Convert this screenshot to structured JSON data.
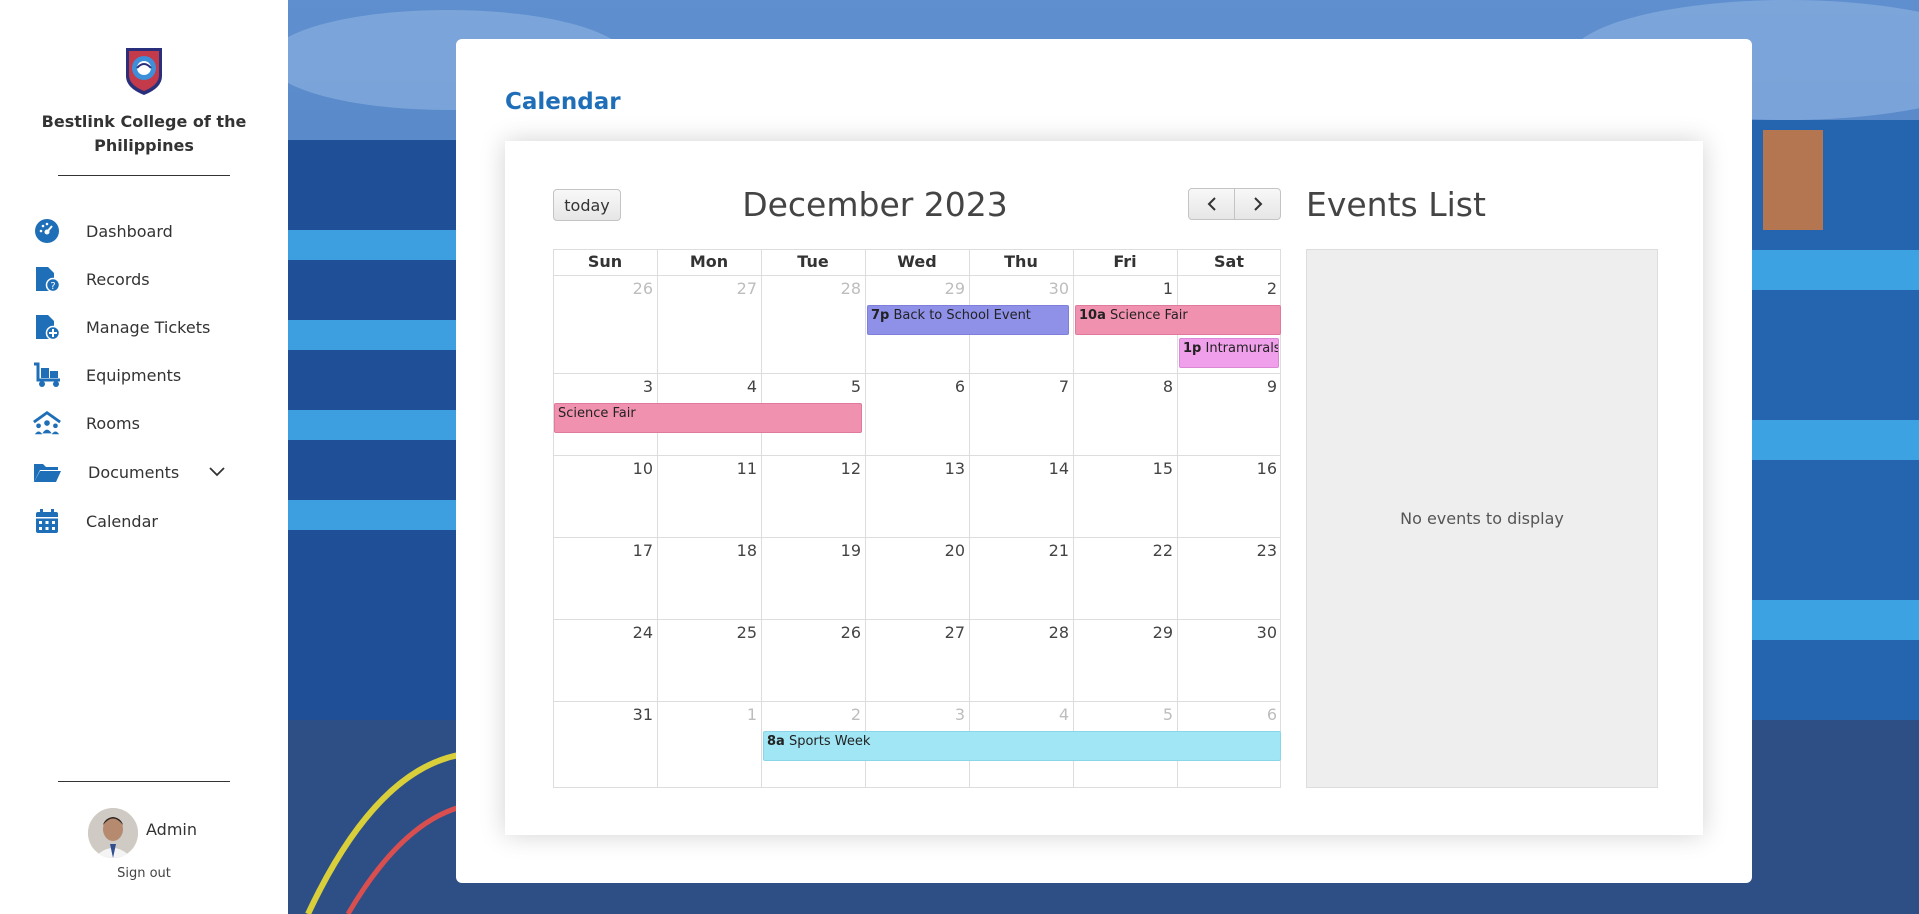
{
  "sidebar": {
    "college_name": "Bestlink College of the Philippines",
    "items": [
      {
        "label": "Dashboard",
        "icon": "dashboard-icon"
      },
      {
        "label": "Records",
        "icon": "records-icon"
      },
      {
        "label": "Manage Tickets",
        "icon": "manage-tickets-icon"
      },
      {
        "label": "Equipments",
        "icon": "equipments-icon"
      },
      {
        "label": "Rooms",
        "icon": "rooms-icon"
      },
      {
        "label": "Documents",
        "icon": "folder-icon"
      },
      {
        "label": "Calendar",
        "icon": "calendar-icon"
      }
    ],
    "user": {
      "name": "Admin",
      "signout": "Sign out"
    }
  },
  "main": {
    "page_title": "Calendar",
    "today_label": "today",
    "prev_icon": "chevron-left-icon",
    "next_icon": "chevron-right-icon",
    "month_title": "December 2023",
    "events_list_title": "Events List",
    "no_events": "No events to display"
  },
  "calendar": {
    "weekdays": [
      "Sun",
      "Mon",
      "Tue",
      "Wed",
      "Thu",
      "Fri",
      "Sat"
    ],
    "weeks": [
      [
        "26",
        "27",
        "28",
        "29",
        "30",
        "1",
        "2"
      ],
      [
        "3",
        "4",
        "5",
        "6",
        "7",
        "8",
        "9"
      ],
      [
        "10",
        "11",
        "12",
        "13",
        "14",
        "15",
        "16"
      ],
      [
        "17",
        "18",
        "19",
        "20",
        "21",
        "22",
        "23"
      ],
      [
        "24",
        "25",
        "26",
        "27",
        "28",
        "29",
        "30"
      ],
      [
        "31",
        "1",
        "2",
        "3",
        "4",
        "5",
        "6"
      ]
    ],
    "events": [
      {
        "time": "7p",
        "title": "Back to School Event",
        "color": "#8f91e8"
      },
      {
        "time": "10a",
        "title": "Science Fair",
        "color": "#f191b0"
      },
      {
        "time": "1p",
        "title": "Intramurals",
        "color": "#f0a0ea"
      },
      {
        "time": "",
        "title": "Science Fair",
        "color": "#f191b0"
      },
      {
        "time": "8a",
        "title": "Sports Week",
        "color": "#a1e6f5"
      }
    ]
  },
  "colors": {
    "accent": "#1f6fb8",
    "sidebar_icon": "#1f6fb8"
  }
}
